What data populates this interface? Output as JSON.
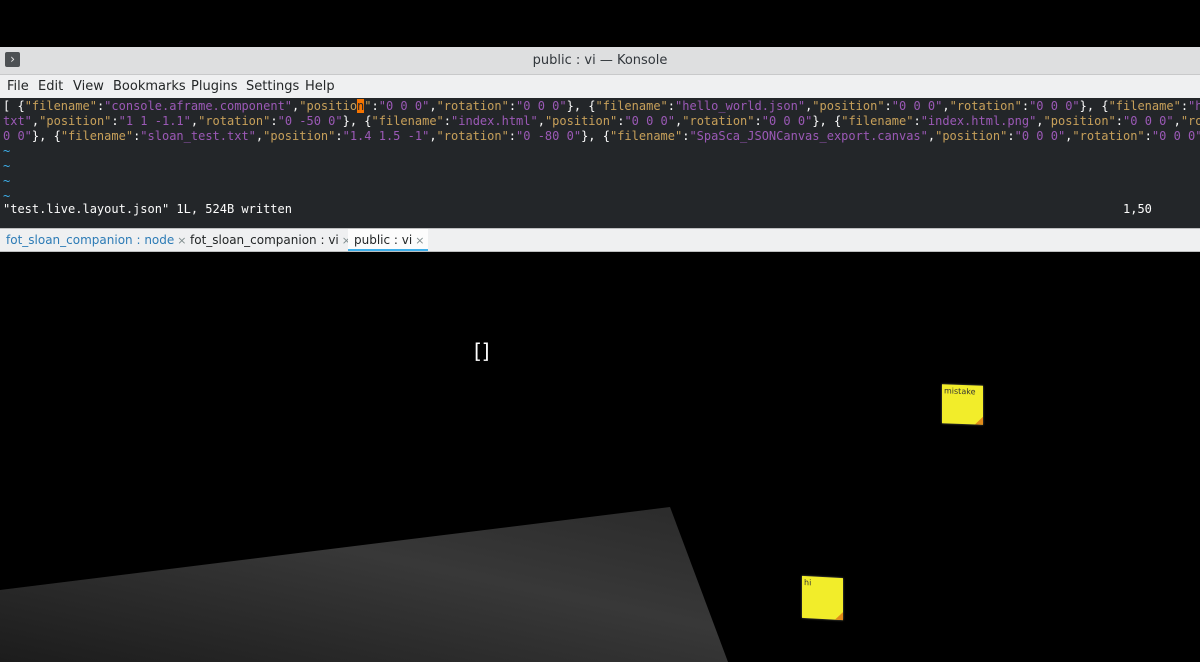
{
  "window": {
    "title": "public : vi — Konsole"
  },
  "menubar": {
    "items": [
      "File",
      "Edit",
      "View",
      "Bookmarks",
      "Plugins",
      "Settings",
      "Help"
    ]
  },
  "terminal": {
    "line1": [
      {
        "t": "[ {",
        "s": "b"
      },
      {
        "t": "\"filename\"",
        "s": "k"
      },
      {
        "t": ":",
        "s": "b"
      },
      {
        "t": "\"console.aframe.component\"",
        "s": "v"
      },
      {
        "t": ",",
        "s": "b"
      },
      {
        "t": "\"positio",
        "s": "k"
      },
      {
        "t": "n",
        "s": "cursor"
      },
      {
        "t": "\"",
        "s": "k"
      },
      {
        "t": ":",
        "s": "b"
      },
      {
        "t": "\"0 0 0\"",
        "s": "v"
      },
      {
        "t": ",",
        "s": "b"
      },
      {
        "t": "\"rotation\"",
        "s": "k"
      },
      {
        "t": ":",
        "s": "b"
      },
      {
        "t": "\"0 0 0\"",
        "s": "v"
      },
      {
        "t": "}, {",
        "s": "b"
      },
      {
        "t": "\"filename\"",
        "s": "k"
      },
      {
        "t": ":",
        "s": "b"
      },
      {
        "t": "\"hello_world.json\"",
        "s": "v"
      },
      {
        "t": ",",
        "s": "b"
      },
      {
        "t": "\"position\"",
        "s": "k"
      },
      {
        "t": ":",
        "s": "b"
      },
      {
        "t": "\"0 0 0\"",
        "s": "v"
      },
      {
        "t": ",",
        "s": "b"
      },
      {
        "t": "\"rotation\"",
        "s": "k"
      },
      {
        "t": ":",
        "s": "b"
      },
      {
        "t": "\"0 0 0\"",
        "s": "v"
      },
      {
        "t": "}, {",
        "s": "b"
      },
      {
        "t": "\"filename\"",
        "s": "k"
      },
      {
        "t": ":",
        "s": "b"
      },
      {
        "t": "\"hello",
        "s": "v"
      }
    ],
    "line2": [
      {
        "t": "txt\"",
        "s": "v"
      },
      {
        "t": ",",
        "s": "b"
      },
      {
        "t": "\"position\"",
        "s": "k"
      },
      {
        "t": ":",
        "s": "b"
      },
      {
        "t": "\"1 1 -1.1\"",
        "s": "v"
      },
      {
        "t": ",",
        "s": "b"
      },
      {
        "t": "\"rotation\"",
        "s": "k"
      },
      {
        "t": ":",
        "s": "b"
      },
      {
        "t": "\"0 -50 0\"",
        "s": "v"
      },
      {
        "t": "}, {",
        "s": "b"
      },
      {
        "t": "\"filename\"",
        "s": "k"
      },
      {
        "t": ":",
        "s": "b"
      },
      {
        "t": "\"index.html\"",
        "s": "v"
      },
      {
        "t": ",",
        "s": "b"
      },
      {
        "t": "\"position\"",
        "s": "k"
      },
      {
        "t": ":",
        "s": "b"
      },
      {
        "t": "\"0 0 0\"",
        "s": "v"
      },
      {
        "t": ",",
        "s": "b"
      },
      {
        "t": "\"rotation\"",
        "s": "k"
      },
      {
        "t": ":",
        "s": "b"
      },
      {
        "t": "\"0 0 0\"",
        "s": "v"
      },
      {
        "t": "}, {",
        "s": "b"
      },
      {
        "t": "\"filename\"",
        "s": "k"
      },
      {
        "t": ":",
        "s": "b"
      },
      {
        "t": "\"index.html.png\"",
        "s": "v"
      },
      {
        "t": ",",
        "s": "b"
      },
      {
        "t": "\"position\"",
        "s": "k"
      },
      {
        "t": ":",
        "s": "b"
      },
      {
        "t": "\"0 0 0\"",
        "s": "v"
      },
      {
        "t": ",",
        "s": "b"
      },
      {
        "t": "\"rotati",
        "s": "k"
      }
    ],
    "line3": [
      {
        "t": "0 0\"",
        "s": "v"
      },
      {
        "t": "}, {",
        "s": "b"
      },
      {
        "t": "\"filename\"",
        "s": "k"
      },
      {
        "t": ":",
        "s": "b"
      },
      {
        "t": "\"sloan_test.txt\"",
        "s": "v"
      },
      {
        "t": ",",
        "s": "b"
      },
      {
        "t": "\"position\"",
        "s": "k"
      },
      {
        "t": ":",
        "s": "b"
      },
      {
        "t": "\"1.4 1.5 -1\"",
        "s": "v"
      },
      {
        "t": ",",
        "s": "b"
      },
      {
        "t": "\"rotation\"",
        "s": "k"
      },
      {
        "t": ":",
        "s": "b"
      },
      {
        "t": "\"0 -80 0\"",
        "s": "v"
      },
      {
        "t": "}, {",
        "s": "b"
      },
      {
        "t": "\"filename\"",
        "s": "k"
      },
      {
        "t": ":",
        "s": "b"
      },
      {
        "t": "\"SpaSca_JSONCanvas_export.canvas\"",
        "s": "v"
      },
      {
        "t": ",",
        "s": "b"
      },
      {
        "t": "\"position\"",
        "s": "k"
      },
      {
        "t": ":",
        "s": "b"
      },
      {
        "t": "\"0 0 0\"",
        "s": "v"
      },
      {
        "t": ",",
        "s": "b"
      },
      {
        "t": "\"rotation\"",
        "s": "k"
      },
      {
        "t": ":",
        "s": "b"
      },
      {
        "t": "\"0 0 0\"",
        "s": "v"
      },
      {
        "t": "} ]",
        "s": "b"
      }
    ],
    "tilde": "~",
    "status_message": "\"test.live.layout.json\" 1L, 524B written",
    "cursor_position": "1,50"
  },
  "tabs": [
    {
      "label": "fot_sloan_companion : node",
      "active": false
    },
    {
      "label": "fot_sloan_companion : vi",
      "active": false
    },
    {
      "label": "public : vi",
      "active": true
    }
  ],
  "tab_close_glyph": "×",
  "app_icon_glyph": "›",
  "scene": {
    "reticle": "[]",
    "notes": [
      {
        "text": "mistake"
      },
      {
        "text": "hi"
      }
    ]
  },
  "colors": {
    "terminal_bg": "#232629",
    "key": "#c7a05a",
    "value": "#9b59b6",
    "cursor": "#f67400",
    "tilde": "#3daee9",
    "sticky": "#f2ed2a",
    "sticky_fold": "#e28b1a"
  }
}
